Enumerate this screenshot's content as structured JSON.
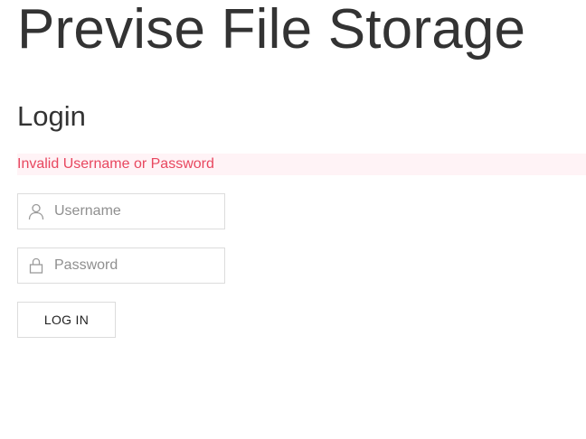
{
  "site": {
    "title": "Previse File Storage"
  },
  "login": {
    "title": "Login",
    "error_message": "Invalid Username or Password",
    "username": {
      "value": "",
      "placeholder": "Username",
      "icon": "user-icon"
    },
    "password": {
      "value": "",
      "placeholder": "Password",
      "icon": "lock-icon"
    },
    "submit_label": "LOG IN"
  },
  "colors": {
    "text": "#333333",
    "error_text": "#e8475f",
    "error_background": "#fff3f6",
    "field_border": "#dcdcdc",
    "placeholder": "#8f8f8f"
  }
}
